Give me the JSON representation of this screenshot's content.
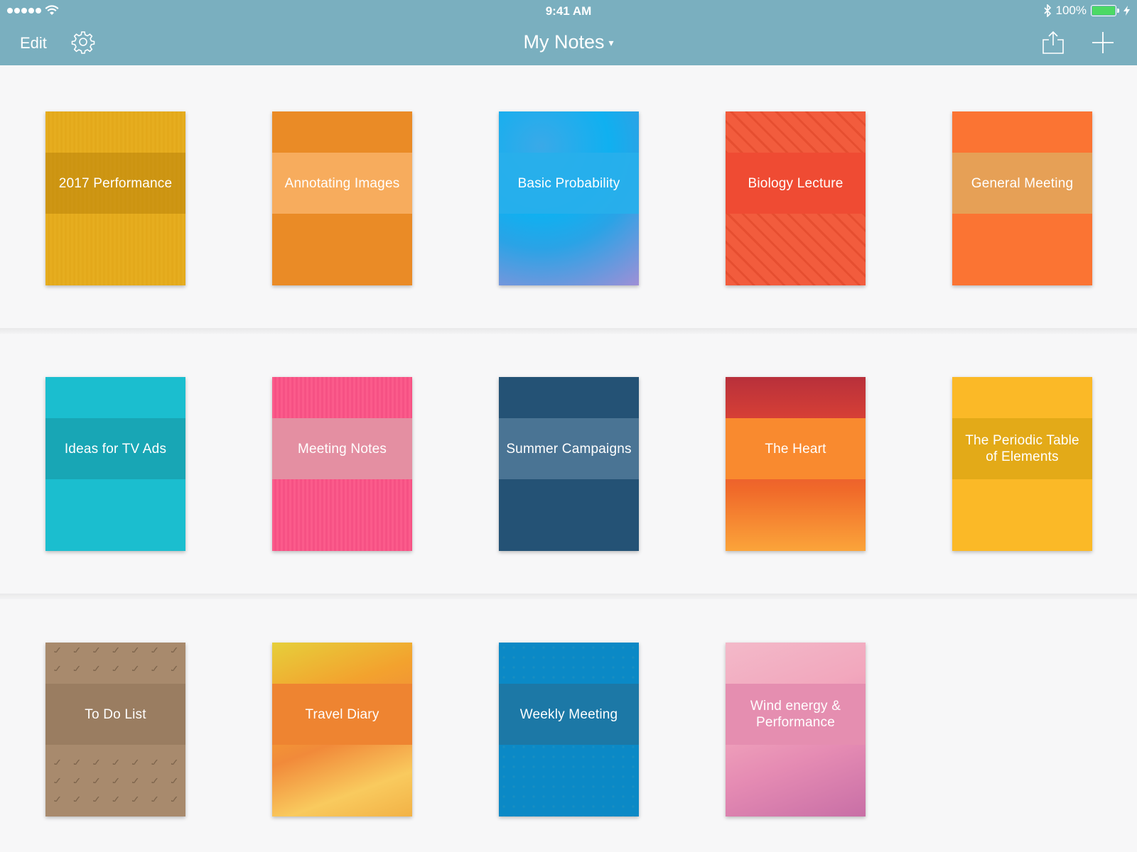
{
  "status_bar": {
    "time": "9:41 AM",
    "battery_pct": "100%",
    "battery_level": 1.0,
    "signal_bars": 5,
    "icons": [
      "signal-dots-icon",
      "wifi-icon",
      "bluetooth-icon",
      "battery-icon",
      "charging-bolt-icon"
    ]
  },
  "toolbar": {
    "edit_label": "Edit",
    "title": "My Notes",
    "title_caret": "▾",
    "icons": [
      "gear-icon",
      "share-icon",
      "plus-icon"
    ]
  },
  "theme": {
    "bar_color": "#7aafbf",
    "background": "#f7f7f8"
  },
  "notebooks": [
    {
      "title": "2017 Performance"
    },
    {
      "title": "Annotating Images"
    },
    {
      "title": "Basic Probability"
    },
    {
      "title": "Biology Lecture"
    },
    {
      "title": "General Meeting"
    },
    {
      "title": "Ideas for TV Ads"
    },
    {
      "title": "Meeting Notes"
    },
    {
      "title": "Summer Campaigns"
    },
    {
      "title": "The Heart"
    },
    {
      "title": "The Periodic Table of Elements"
    },
    {
      "title": "To Do List"
    },
    {
      "title": "Travel Diary"
    },
    {
      "title": "Weekly Meeting"
    },
    {
      "title": "Wind energy & Performance"
    }
  ]
}
